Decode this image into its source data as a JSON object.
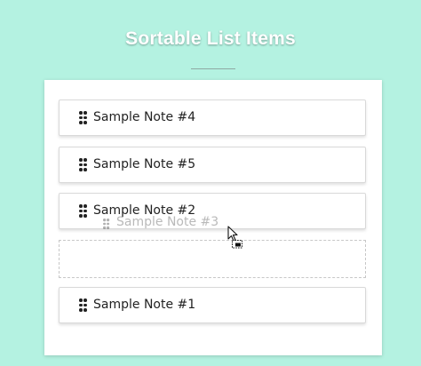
{
  "page": {
    "title": "Sortable List Items"
  },
  "list": {
    "items": [
      {
        "label": "Sample Note #4"
      },
      {
        "label": "Sample Note #5"
      },
      {
        "label": "Sample Note #2"
      },
      {
        "label": "Sample Note #1"
      }
    ],
    "dragging_item": {
      "label": "Sample Note #3"
    }
  },
  "icons": {
    "grip": "drag-handle-icon",
    "cursor": "move-cursor-icon"
  },
  "colors": {
    "background": "#b4f2e1",
    "card": "#ffffff",
    "text": "#222222",
    "title": "#ffffff"
  }
}
